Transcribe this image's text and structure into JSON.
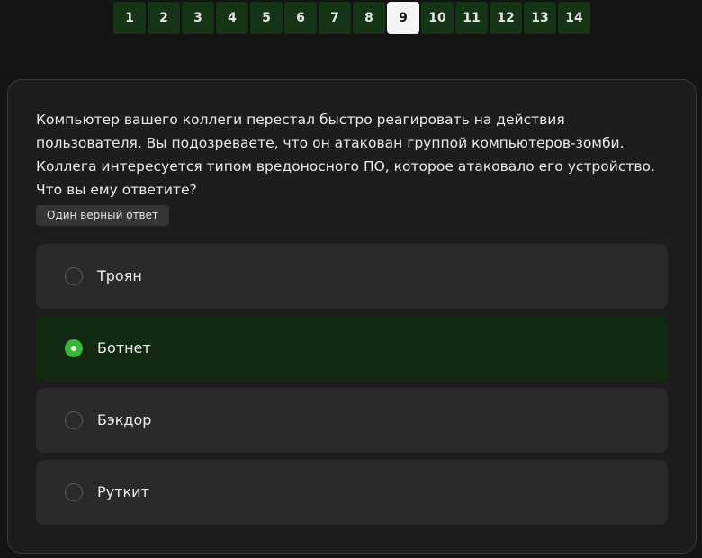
{
  "pagination": {
    "pages": [
      "1",
      "2",
      "3",
      "4",
      "5",
      "6",
      "7",
      "8",
      "9",
      "10",
      "11",
      "12",
      "13",
      "14"
    ],
    "current": "9"
  },
  "question": {
    "text": "Компьютер вашего коллеги перестал быстро реагировать на действия пользователя. Вы подозреваете, что он атакован группой компьютеров-зомби. Коллега интересуется типом вредоносного ПО, которое атаковало его устройство. Что вы ему ответите?",
    "answer_type": "Один верный ответ"
  },
  "options": [
    {
      "label": "Троян",
      "selected": false
    },
    {
      "label": "Ботнет",
      "selected": true
    },
    {
      "label": "Бэкдор",
      "selected": false
    },
    {
      "label": "Руткит",
      "selected": false
    }
  ],
  "colors": {
    "page_button": "#163416",
    "page_button_active": "#f4f4f4",
    "selected_option": "#112a11",
    "radio_checked": "#3bb53b"
  }
}
